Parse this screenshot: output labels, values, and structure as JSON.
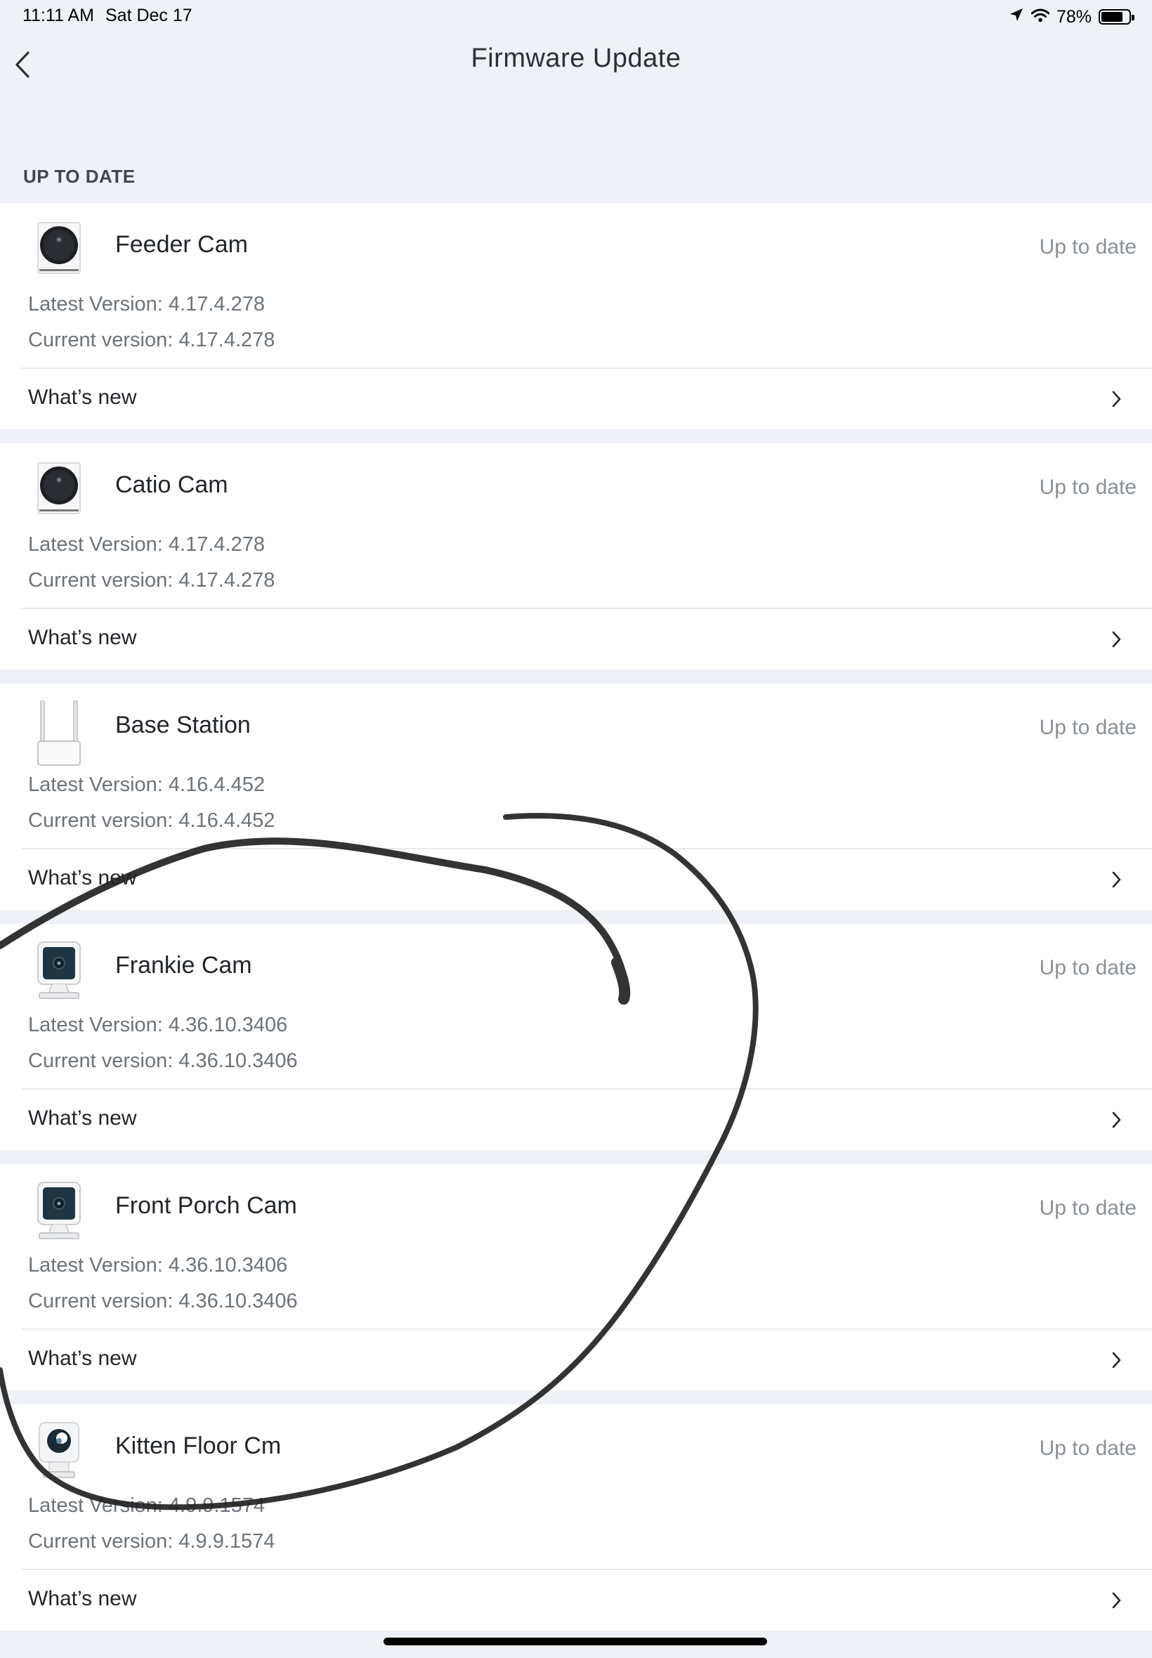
{
  "status_bar": {
    "time": "11:11 AM",
    "date": "Sat Dec 17",
    "battery": "78%",
    "battery_level": 0.78
  },
  "nav": {
    "title": "Firmware Update"
  },
  "section": {
    "header": "UP TO DATE"
  },
  "devices": [
    {
      "name": "Feeder Cam",
      "status": "Up to date",
      "latest": "Latest Version: 4.17.4.278",
      "current": "Current version: 4.17.4.278",
      "whats_new": "What’s new",
      "icon": "outdoor-cam-icon"
    },
    {
      "name": "Catio Cam",
      "status": "Up to date",
      "latest": "Latest Version: 4.17.4.278",
      "current": "Current version: 4.17.4.278",
      "whats_new": "What’s new",
      "icon": "outdoor-cam-icon"
    },
    {
      "name": "Base Station",
      "status": "Up to date",
      "latest": "Latest Version: 4.16.4.452",
      "current": "Current version: 4.16.4.452",
      "whats_new": "What’s new",
      "icon": "base-station-icon"
    },
    {
      "name": "Frankie Cam",
      "status": "Up to date",
      "latest": "Latest Version: 4.36.10.3406",
      "current": "Current version: 4.36.10.3406",
      "whats_new": "What’s new",
      "icon": "cube-cam-icon"
    },
    {
      "name": "Front Porch Cam",
      "status": "Up to date",
      "latest": "Latest Version: 4.36.10.3406",
      "current": "Current version: 4.36.10.3406",
      "whats_new": "What’s new",
      "icon": "cube-cam-icon"
    },
    {
      "name": "Kitten Floor Cm",
      "status": "Up to date",
      "latest": "Latest Version: 4.9.9.1574",
      "current": "Current version: 4.9.9.1574",
      "whats_new": "What’s new",
      "icon": "mini-cam-icon"
    }
  ]
}
